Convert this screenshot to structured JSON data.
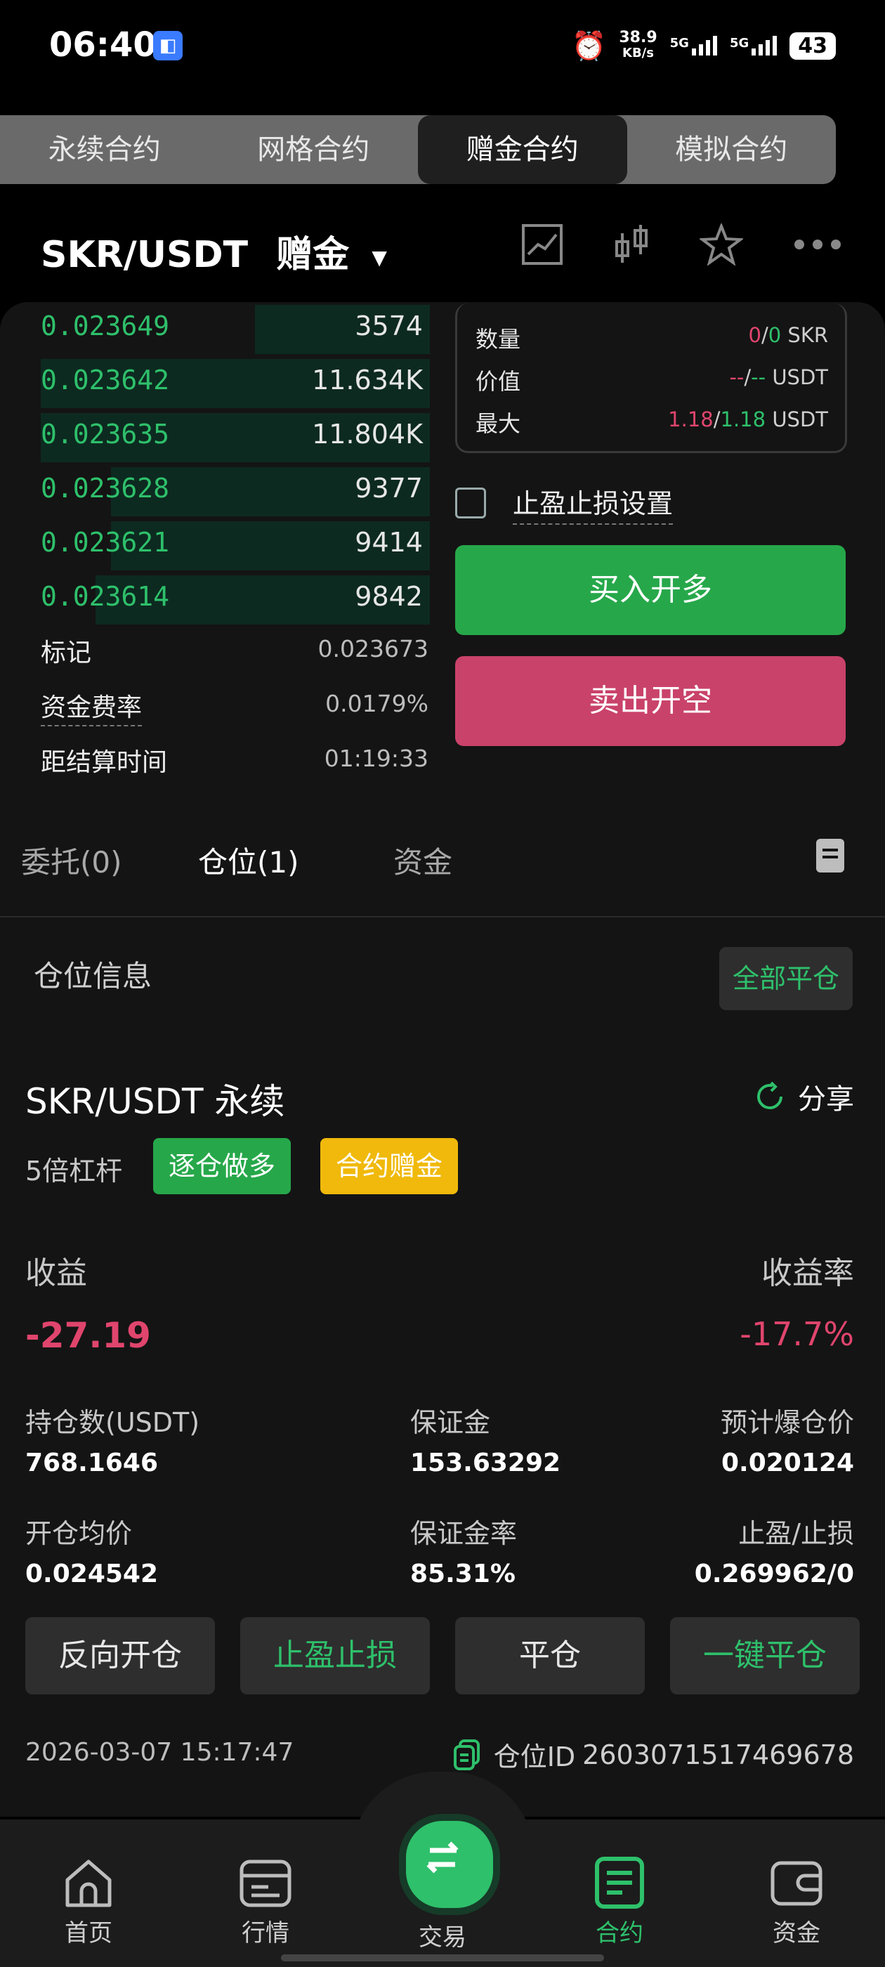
{
  "status_bar": {
    "time": "06:40",
    "net_speed": "38.9",
    "net_unit": "KB/s",
    "signal1": "5G",
    "signal2": "5G",
    "battery": "43"
  },
  "top_tabs": [
    "永续合约",
    "网格合约",
    "赠金合约",
    "模拟合约"
  ],
  "header": {
    "pair": "SKR/USDT",
    "mode": "赠金"
  },
  "orderbook": {
    "rows": [
      {
        "price": "0.023649",
        "amount": "3574",
        "depth": 0.45
      },
      {
        "price": "0.023642",
        "amount": "11.634K",
        "depth": 1.0
      },
      {
        "price": "0.023635",
        "amount": "11.804K",
        "depth": 1.0
      },
      {
        "price": "0.023628",
        "amount": "9377",
        "depth": 0.82
      },
      {
        "price": "0.023621",
        "amount": "9414",
        "depth": 0.82
      },
      {
        "price": "0.023614",
        "amount": "9842",
        "depth": 0.86
      }
    ],
    "mark_label": "标记",
    "mark_value": "0.023673",
    "funding_label": "资金费率",
    "funding_value": "0.0179%",
    "settle_label": "距结算时间",
    "settle_value": "01:19:33"
  },
  "order_box": {
    "qty_label": "数量",
    "qty_a": "0",
    "qty_b": "0",
    "qty_unit": "SKR",
    "value_label": "价值",
    "value_a": "--",
    "value_b": "--",
    "value_unit": "USDT",
    "max_label": "最大",
    "max_a": "1.18",
    "max_b": "1.18",
    "max_unit": "USDT",
    "tpsl_label": "止盈止损设置",
    "buy_label": "买入开多",
    "sell_label": "卖出开空"
  },
  "sub_tabs": [
    "委托(0)",
    "仓位(1)",
    "资金"
  ],
  "position": {
    "section_title": "仓位信息",
    "close_all": "全部平仓",
    "symbol": "SKR/USDT 永续",
    "share": "分享",
    "leverage": "5倍杠杆",
    "tag_side": "逐仓做多",
    "tag_bonus": "合约赠金",
    "pnl_label": "收益",
    "pnl_rate_label": "收益率",
    "pnl": "-27.19",
    "pnl_rate": "-17.7%",
    "size_label": "持仓数(USDT)",
    "size": "768.1646",
    "margin_label": "保证金",
    "margin": "153.63292",
    "liq_label": "预计爆仓价",
    "liq": "0.020124",
    "entry_label": "开仓均价",
    "entry": "0.024542",
    "margin_ratio_label": "保证金率",
    "margin_ratio": "85.31%",
    "tpsl_label": "止盈/止损",
    "tpsl": "0.269962/0",
    "btn_reverse": "反向开仓",
    "btn_tpsl": "止盈止损",
    "btn_close": "平仓",
    "btn_quick_close": "一键平仓",
    "time": "2026-03-07 15:17:47",
    "id_label": "仓位ID",
    "id": "2603071517469678"
  },
  "bottom_nav": [
    "首页",
    "行情",
    "交易",
    "合约",
    "资金"
  ],
  "colors": {
    "green": "#2ec06b",
    "red": "#e0456d",
    "buy": "#26a84a",
    "sell": "#c9426a",
    "bonus_tag": "#f0b90b"
  }
}
